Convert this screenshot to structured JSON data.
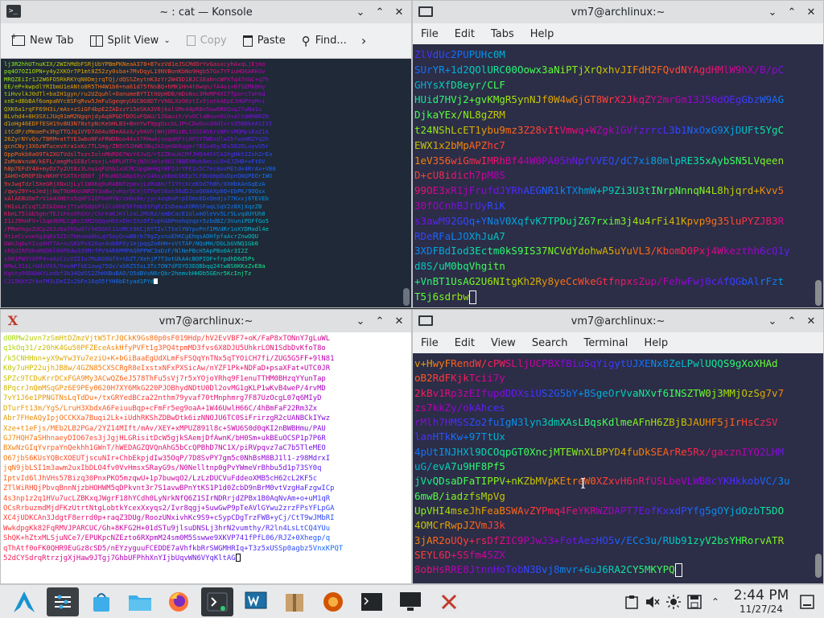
{
  "konsole": {
    "title": "~ : cat — Konsole",
    "toolbar": {
      "new_tab": "New Tab",
      "split_view": "Split View",
      "copy": "Copy",
      "paste": "Paste",
      "find": "Find..."
    },
    "lines": [
      "lj3R2hhUTnuKIX/2WIhMdbFSRjUbYPBmPKNeaA378+B7vzVd1eJSCMdOrYvGasxcyhAxqLjEjmo",
      "pq4O7OZ1OPN+y4y2XKOr7P1mt8Z52zy0sba+7MvDqyL19NVBonKbNo9Hgb57Gx7YFiuHO6ARKGv",
      "MRQZEiIr1J2W6FO5RkRKYqN0DmjrqTQj/dQSSZeytnK3zYr2W45D1BJCSEahncWPXfq47nGC+q7h",
      "EE/eP+kwpdlYRIbmU1eANto8R5TH4W1b0+na61d75fNsBQ+hMK1Hn4t6wqn/fA4oi+BfSEMkBHy",
      "tiHvvlkJ0dTl+baIH1gyn/ru2UZquhl+OanumeBYTIthUpHDB/mDsNsc3MeMP4XIfTporcTahkd",
      "xnE+dBbBAf6ompaNYc8SFqRvw5JmFuSgeqeyUGC8G8DTrVhGLXzO0ztIx9jutkAEpEJHGPVgM+i",
      "QXK6a1rqFF69H3i/mAs+zSiGF4bpE2ZADzzYi5eSKA3V6jkxlSMs44pR8o5uw6R8QsqJ7wNa1u",
      "BLvhd4+8H3SXiJUq91mM2NgqnjdyAq8PGDfDOSuFQAU/1JGauiY/VvOClaBvw+OiO+AlYdHM8RZ0",
      "d1oHg46EDFfESH19v8N3N78xtpNcKebHLB3+BnnYwf9pgQscbLJPnCDwOoxd8dIvrs35BBkeASIVI",
      "itCdP/zMmaePx3hpTTQJq1VYD7A64u9DeAGzA/y94VhjNHjOMSzBLtSSS4h6rsNPcsMQMpsEaZ1k",
      "26ZyrNYvQs/TBRM+atTYE3wboNFxFRWDNoo44xXfRHwAjooqaKFtLHFSYTWDxdlwIhfwaHRZYq2h",
      "gcnCNyj3X6zWTucevXra1xKc7TLSmg/ZN5V52HWE3BqJXZqeGK6qgmr7BIo46yJDs582DLuyvU5r",
      "OppPokb0a09TkZXGTVdslTxzcIolnMbRO67WzY6JwQ/r5ZZKaukCMfJHQ44SYCA3XgHkt2Zsh2rEa",
      "ZoMxWxnuW/kEFL/amgMsSE8zlnsxjL+6PLHTFhjN3V3ele9U17BBEXRub8eccLO+EJZHB+vFt6V",
      "h8p7EFdY48+myOz7y2Ut8z3LnuiqFUhG1xUCMCUpgWeHgYBPIdrYPE1x5C7ec8ovMEtde4RrAx+V80",
      "3AHO+DROP3bvNKHFYSXTXrQO8f jF0uHG5A0p1Xyv14ksybbmb5KEp7LFBoUmpDuDpnQNQPEOrIWO",
      "9vJwqTdzl5XeGRjXNxUjLyl1WXKq9uRABNfzpmvjLzRo8m/f1YYcXceEOd7h8h/XXHbkAnGqEzA",
      "/qwy29Y+sJedjjNqT9bHUoUNR5Y3aBwjvKqrOCXjSTFwtS6xh38dDJcoQ08AXp8Q+EbPK/9OQsx",
      "xAlAEBUOmTrV1A4XHEto5qHFS1QFbeMYW/zmbu8e/jyc4zq0aPrpIOmxEDxQedjs77Kxxj6TEVEb",
      "YH1sLzCcqTLDIAImaxjTtw05dpUP1GlsOhE5Ffmb3tFqFzIsDaauXORhSFaqLSqV2z8XjXqzZB",
      "KbnL75lGb5gmrTEJ1FevXhSXr/ChrKaKJKYlzaL2MV8z/emDCacE1UlxmOleVv5Lr5LvqdUYUh8",
      "21iJ9hHFV+lSqA9DMLCgbcSXM2GQqaHbSxEHrZXzOfIvphG0PnnhqVqz+5zbdBZ/3VuniPDFfGo5",
      "/PRmVngxZdCp2XJz6afh5wO7rh65GHl1ScMCt9KCjBYTIvlTtelYNYpvPnfIMVdRr1oXYDMadl4e",
      "9tieCcvveXg3q6V32InTmmxma0kLqY5ayQvwBBrb78gZyxnxEhKCgEhqsAOHfpfaAcrZnwOQU",
      "GWoJq6wYIxq0HT7A+ouSKVPxX26q+4obNFEy1mjpqqZo6HH+sVtTAP/NQoMH/DbLbGVNQ1Gb0",
      "shQdIRFUkaREDbl00PEdw339MrfPV9AR8PMPAQRPPWC3aDzF/NlNePBcH5ApPBo0Ar3I2Z",
      "s991PW3YXPP4+aAsCicVZIIu7MuN30GfX+tbZT/XehjP7T3otUkA4cBOPIOF+frpdhD6d5Ps",
      "8MwL31AL+UdxVXX/VavmPfbE1owg75Qv/xb6Z55sL3Tc7ON7dFDYO3EQBbqq24twBS0KKxZvE8a",
      "Kgkty90DGbKYLedbf3b34QdSS2ZhHXBuBAO/O5dBVsN6rQbr2hemvbHHDb5GEnr5KcInjTz",
      "CJ15KKtZtknFM3LDmIZx2bFn16qO5fYH8bEtyad1PYd"
    ]
  },
  "vm7_top": {
    "title": "vm7@archlinux:~",
    "menu": [
      "File",
      "Edit",
      "Tabs",
      "Help"
    ],
    "lines": [
      "ZlVdUc2PUPUHc0M",
      "SUrYR+1d2QOlURC00Oowx3aNiPTjXrQxhvJIFdH2FQvdNYAgdHMlW9hX/B/pC",
      "GHYsXfD8eyr/CLF",
      "HUid7HVj2+gvKMgR5ynNJf0W4wGjGT8WrX2JkqZY2mrGm13J50dOEgGbzW9AG",
      "DjkaYEx/NL8gZRM",
      "t24NShLcET1ybu9mz3Z28vItVmwq+WZgk1GVfzrrcL3b1NxOxG9XjDUFt5YgC",
      "EWX1x2bMpAPZhc7",
      "1eV356wiGmwIMRhBf44W0PA05hNpfVVEQ/dC7xi80mlpRE35xAybSN5LVqeen",
      "D+cU8idich7pM8S",
      "99OE3xR1jFrufdJYRhAEGNR1kTXhmW+P9Zi3U3tINrpNnnqN4L8hjqrd+Kvv5",
      "30fOCnhBJrUyRiK",
      "s3awM92GQq+YNaV0XqfvK7TPDujZ67rxim3j4u4rFi41Kpvp9g35luPYZJB3R",
      "RDeRFaLJOXhJuA7",
      "3XDFBdIod3Ectm0kS9IS37NCVdYdohwA5uYuVL3/KbomD0Pxj4Wkezthh6cQ1y",
      "d8S/uM0bqVhgitn",
      "+VnBT1UsAG2U6NItgKh2Ry8yeCcWkeGtfnpxsZup/FehwFwj0cAfQGbAlrFzt",
      "T5j6sdrbw"
    ]
  },
  "xterm": {
    "title": "vm7@archlinux:~",
    "lines": [
      "dORMw2uvn7zSmHtDZmzVjtW5TrJQCkK9Gs80p0sF019Hdp/hV2EvVBF7+oK/FaP8xTONnY7gLuWL",
      "q1kOq31/z20hK4Gu50PFZEceAskHfyPVFt1g3PQ4tpmMD3fvs6X8DJU5UhkrLON1SdbDvKfoT8o",
      "/k5CNHHnn+yX9wYw3Yu7eziU+K+bGiBaaEgUdXLmFsFSQqYnTNx5qTYOiCH7fi/ZUG5G5FF+9lN81",
      "K0y7uHP22ujhJB8w/4GZN85CXSCRgR8eIxstxNFxPXSicAw/nYZF1Pk+NDFaD+psaXFat+UTC0JR",
      "SPZc9TCDuKrrDCxFGA9My3ACwQZ6eJ578ThFu5sVj7r5xYOjoYRhq9F1enuTTHM0BHzqYYunTap",
      "8PqcrJnQmMSqGPz6E9PEy0620H7XY6MkG220PJOBhydNDtU0Dl2ovMG1gKLP1wKvB4weP/4rvMD",
      "7vY1J6e1PPNGTNsLqTdDu+/txGRYedBCza22nthm79yvaf70tMnphmrg7F87UzOcgL07q6MIyD",
      "DTurFt13m/YgS/LruH3XbdxA6FeiuuBqp+cFmFr5eg9oaA+1W46UwlH66C/4hBmFaF22Rm3Zx",
      "Abr7FHeAQyIpjOCCKXa7Buqi2Lk+iUdhRKShZDBwDtk6izNNOJU6TC0SiFrirzgR2cUANBCkIYwz",
      "Xze+t1eFjs/MEb2LB2PGa/2YZ14MIft/mAv/XEY+xMPUZ891l8c+SWU6S0d0qKI2nBWBHmu/PAU",
      "GJ7HQH7aSHhnaeyDIO67es3jJgjHLGRisitDcW5gjkSAemjDfAwnK/bH0Sm+ukBEuOCSP1p7P6R",
      "BXwNzGIqYvrpaYnQekhh1GWnT/hWEDAGZQVQnAhG5bCcQPBhD7NC1X/piRVpqvz7aC7b5TleMEO",
      "O67jbS6KUsYQBcXOEUTjscuNIr+ChbEkpjdIw35OqP/7D8SvPY7gm5c0NhBsM8BJ1l1-z98MdrxI",
      "jqN9jbLSI1m3awm2uxIbDLO4fv0VvHmsxSRayG9s/N0Nelltnp0gPvYWmeVrBhbu5d1p73SY0q",
      "IptvId6lJhVHs57Bizq30PnxPKO5mzqwU+1p7buwqO2/LzLzDUCVuFddeoXMB5cH62cL2KF5c",
      "ZTlWiRHQjPbvqBnnNjzbHOHWM5qDPkvnt3r7S1avwBPnYtKS1P1d0ZcbD9nBrM0vtVzgHaFzgwICp",
      "4s3np1z2q1HVu7ucLZBKxqJWgrF18hYCdh0LyNrkNfQ6Z1SIrNDRrjdZPBx1B0AqNvAm+o+uM1qR",
      "OCsRrbuzmdMjdFKzUtrtNtgLobtkYcexXxyqs2/Ivr8qgj+SuwGwP9pTeAVlGYwu2zrzFPsYFLpGA",
      "XC4jUDKCAn3JdgtF8errd0p+raqZ3DUg/RoozUNxivhKc9S9+cSypCDgTrzFWB+yCj/CtT9wJMbRI",
      "WwkdpgKk82FqRMVJPARCUC/Gh+8KFG2H+01dSTu9jlsuDNSLj3hrN2vumthy/R2ln4LsLtCQ4YUu",
      "ShQK+hZtxMLSjuNCe7/EPUKpcNZEzto6RXpmM24sm0M5Sswwe9XKVP741fPfL06/RJZ+0Xhegp/q",
      "qThAtf0oFK0QHR9EuGz8cSD5/nEYzyguuFCEDDE7aVhfkbRrSWGMHRIq+T3z5xUSSp0agbz5VnxKPQT",
      "52dCYSdrqRtrzjgXjHaw9JTgj7GhbUFPhhXnYIjbUqvWN6VYqKltAG"
    ]
  },
  "vm7_bottom": {
    "title": "vm7@archlinux:~",
    "menu": [
      "File",
      "Edit",
      "View",
      "Search",
      "Terminal",
      "Help"
    ],
    "lines": [
      "v+HwyFRendW/cPWSLljUCPBXfBiu5qYigytUJXENx8ZeLPwlUQQS9gXoXHAd",
      "oB2RdFKjkTcii7y",
      "2kBv1Rp3zEIfupdDDXsiUS2G5bY+BSgeOrVvaNXvf6INSZTW0j3MMjOzSg7v7",
      "zs7kkZy/okAhces",
      "rMlh7HMSSZo2fuIgN3lyn3dmXAsLBqsKdlmeAFnH6ZBjBJAUHF5jIrHsCzSV",
      "lanHTkKw+97TtUx",
      "4pUtINJHXl9DCOqpGT0XncjMTEWnXLBPYD4fuDkSEArRe5Rx/gacznIYQ2LHM",
      "uG/evA7u9HF8Pf5",
      "jVvQDsaDFaTIPPV+nKZbMVpKEtreW0XZxvH6nRfUSLbeVLWB8cYKHkkobVC/3u",
      "6mwB/iadzfsMpVg",
      "UpVHI4mseJhFeaBSWAvZYPmq4FeYKRWZDAPT7EofKxxdPYfg5gOYjdOzbT5DO",
      "4OMCrRwpJZVmJ3k",
      "3jAR2oUQy+rsDfZIC9PJwJ3+FotAezHO5v/ECc3u/RUb91zyV2bsYHRorvATR",
      "SEYL6D+SSfm45ZX",
      "8obHsRRE8JtnnHoTobN3Bvj8mvr+6uJ6RA2CY5MKYPQ"
    ]
  },
  "taskbar": {
    "clock_time": "2:44 PM",
    "clock_date": "11/27/24"
  },
  "colors": {
    "konsole_bg": "#1f2937",
    "vm7_bg": "#2c2d47",
    "xterm_bg": "#ffffff",
    "accent": "#3daee9"
  }
}
